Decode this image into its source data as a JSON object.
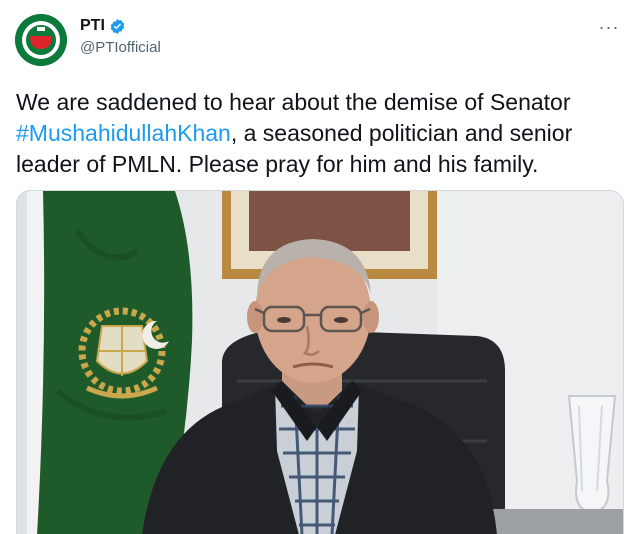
{
  "author": {
    "display_name": "PTI",
    "handle": "@PTIofficial",
    "verified": true
  },
  "more_button": {
    "label": "···"
  },
  "tweet": {
    "text_before": "We are saddened to hear about the demise of Senator ",
    "hashtag": "#MushahidullahKhan",
    "text_after": ", a seasoned politician and senior leader of PMLN. Please pray for him and his family."
  },
  "colors": {
    "accent": "#1d9bf0",
    "text": "#0f1419",
    "secondary_text": "#536471",
    "flag_green": "#1f5b2a"
  },
  "icons": {
    "avatar": "pti-logo",
    "verified": "verified-badge-icon",
    "more": "more-options-icon"
  }
}
